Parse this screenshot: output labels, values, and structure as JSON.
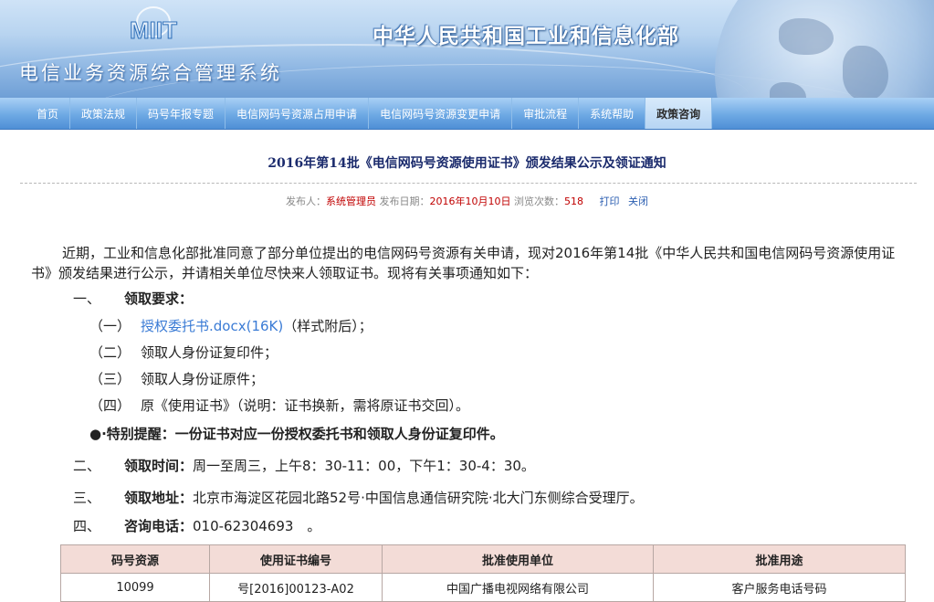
{
  "header": {
    "ministry_name": "中华人民共和国工业和信息化部",
    "system_name": "电信业务资源综合管理系统",
    "logo_text": "MIIT"
  },
  "nav": {
    "items": [
      {
        "label": "首页"
      },
      {
        "label": "政策法规"
      },
      {
        "label": "码号年报专题"
      },
      {
        "label": "电信网码号资源占用申请"
      },
      {
        "label": "电信网码号资源变更申请"
      },
      {
        "label": "审批流程"
      },
      {
        "label": "系统帮助"
      },
      {
        "label": "政策咨询",
        "active": true
      }
    ]
  },
  "article": {
    "title": "2016年第14批《电信网码号资源使用证书》颁发结果公示及领证通知",
    "meta": {
      "publisher_label": "发布人：",
      "publisher": "系统管理员",
      "date_label": "发布日期：",
      "date": "2016年10月10日",
      "views_label": "浏览次数：",
      "views": "518",
      "print_label": "打印",
      "close_label": "关闭"
    },
    "intro": "近期，工业和信息化部批准同意了部分单位提出的电信网码号资源有关申请，现对2016年第14批《中华人民共和国电信网码号资源使用证书》颁发结果进行公示，并请相关单位尽快来人领取证书。现将有关事项通知如下：",
    "section1": {
      "num": "一、",
      "label": "领取要求：",
      "items": [
        {
          "num": "（一）",
          "link": "授权委托书.docx(16K)",
          "text": "（样式附后）；"
        },
        {
          "num": "（二）",
          "text": "领取人身份证复印件；"
        },
        {
          "num": "（三）",
          "text": "领取人身份证原件；"
        },
        {
          "num": "（四）",
          "text": "原《使用证书》（说明：证书换新，需将原证书交回）。"
        }
      ],
      "reminder": "●·特别提醒：一份证书对应一份授权委托书和领取人身份证复印件。"
    },
    "section2": {
      "num": "二、",
      "label": "领取时间：",
      "text": "周一至周三，上午8：30-11：00，下午1：30-4：30。"
    },
    "section3": {
      "num": "三、",
      "label": "领取地址：",
      "text": "北京市海淀区花园北路52号·中国信息通信研究院·北大门东侧综合受理厅。"
    },
    "section4": {
      "num": "四、",
      "label": "咨询电话：",
      "text": "010-62304693　。"
    }
  },
  "table": {
    "headers": [
      "码号资源",
      "使用证书编号",
      "批准使用单位",
      "批准用途"
    ],
    "rows": [
      [
        "10099",
        "号[2016]00123-A02",
        "中国广播电视网络有限公司",
        "客户服务电话号码"
      ]
    ]
  },
  "colors": {
    "nav_blue": "#5b9ae0",
    "title_navy": "#1a2a6c",
    "meta_red": "#c00000",
    "link_blue": "#3a7bd5",
    "table_header_bg": "#f3dcd7"
  }
}
